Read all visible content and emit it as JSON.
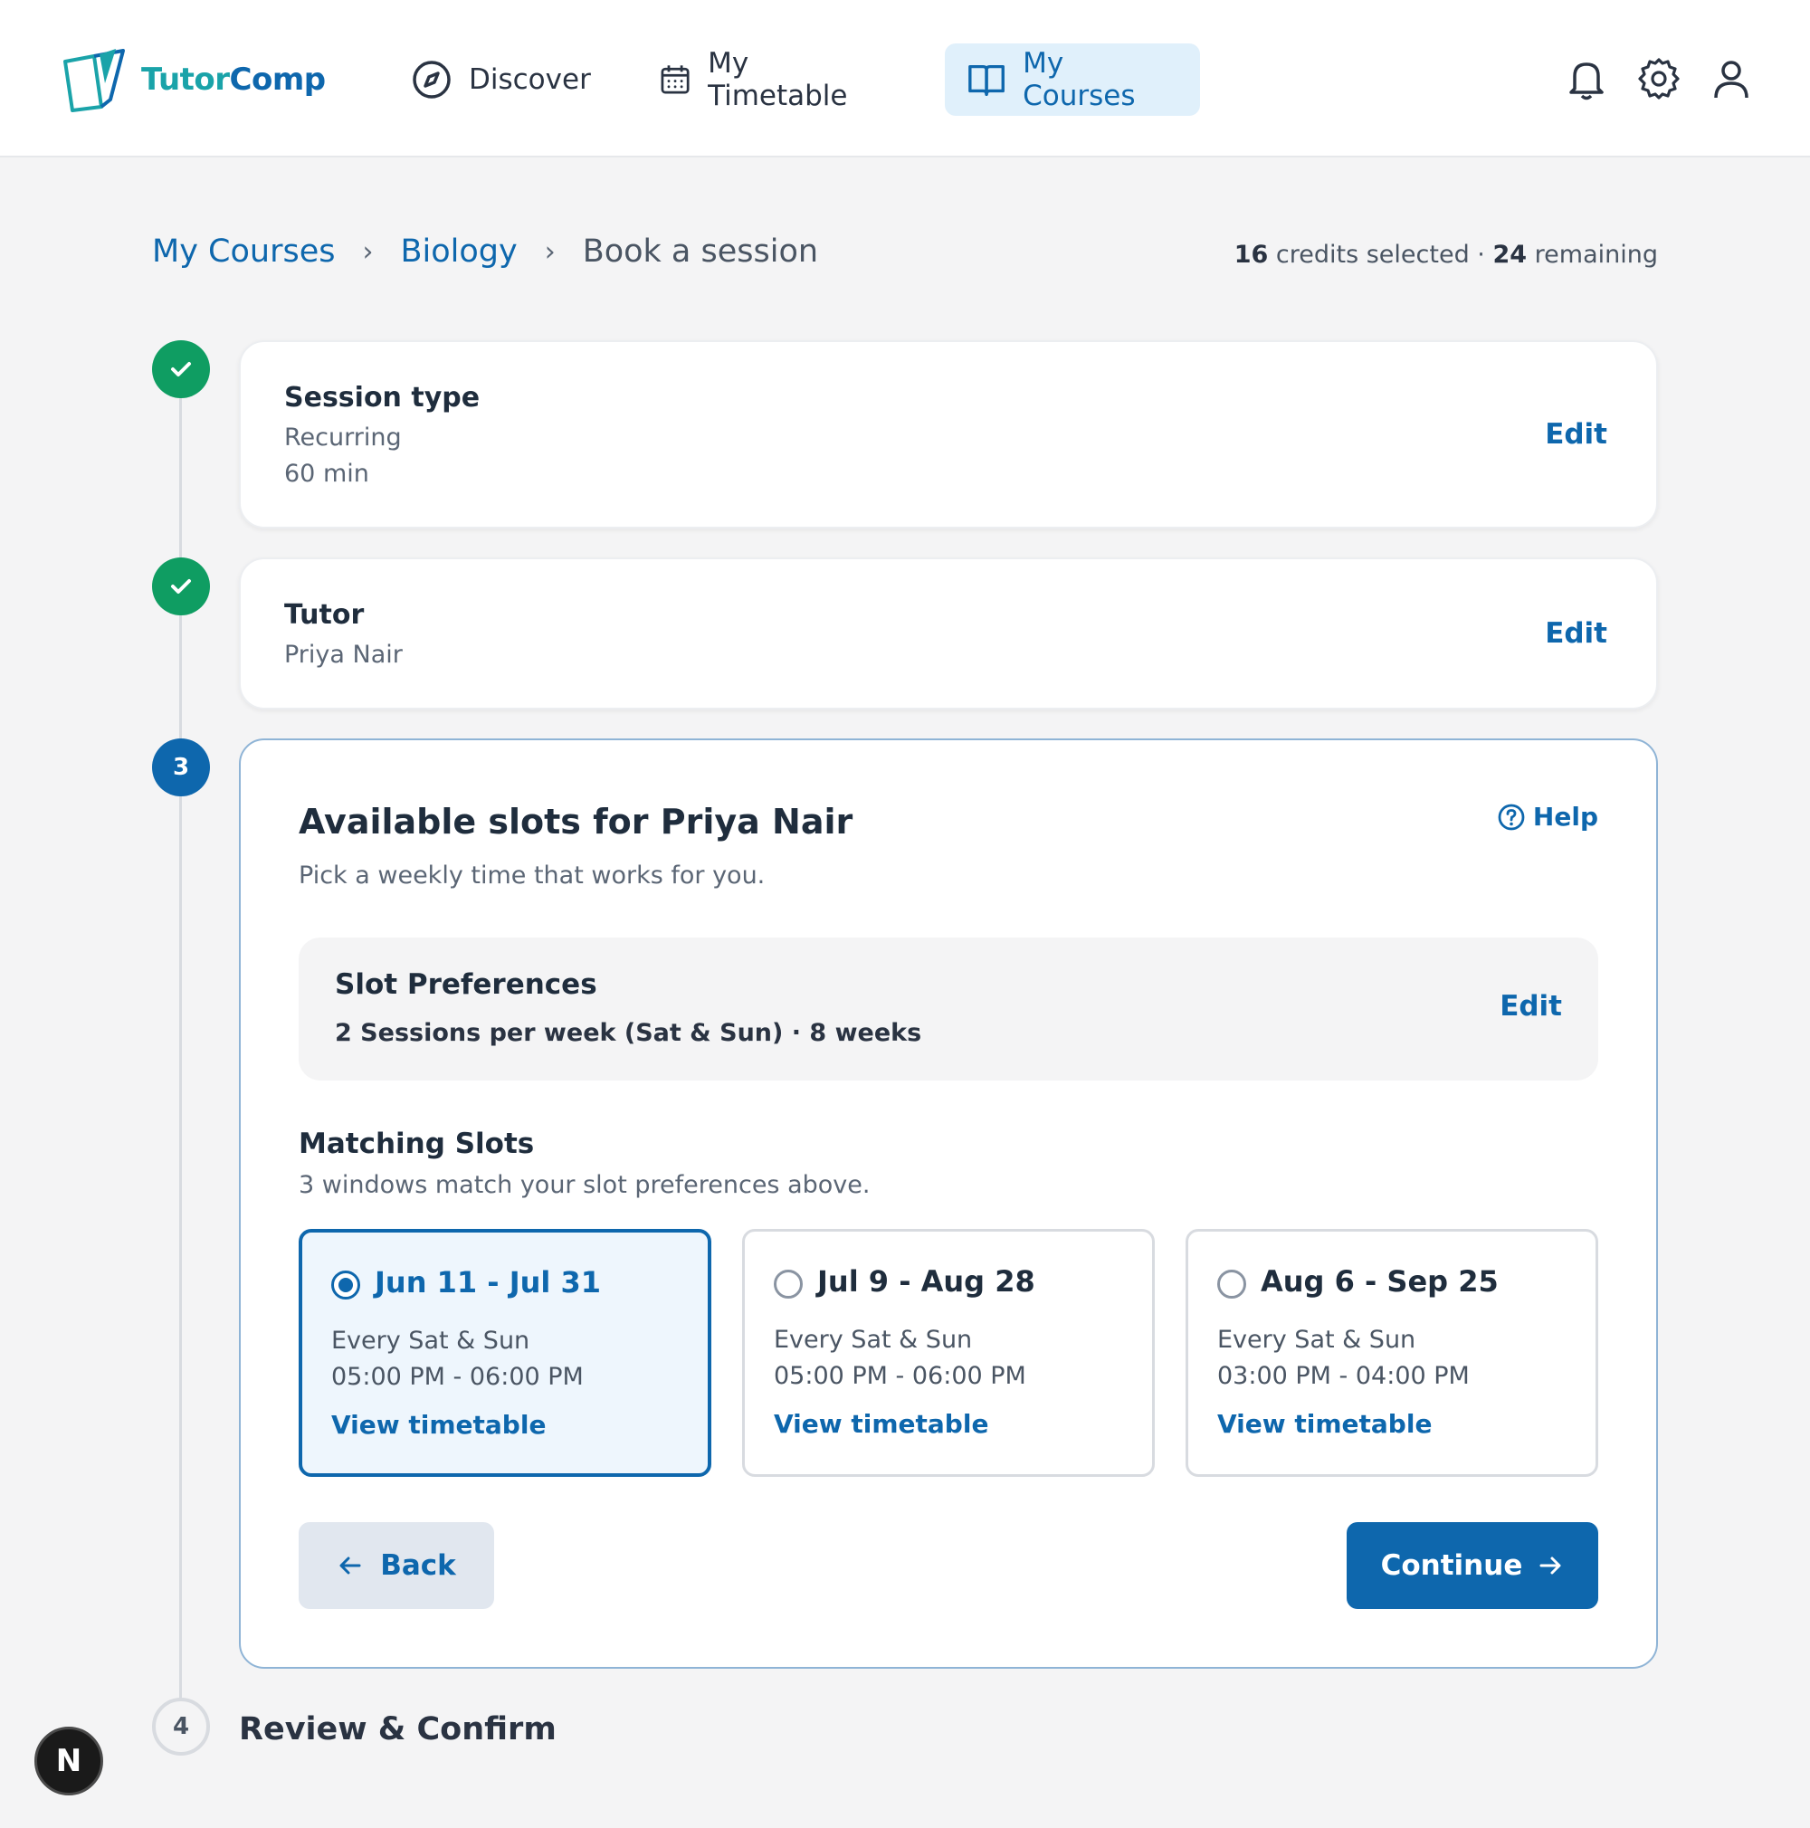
{
  "app": {
    "logo_part1": "Tutor",
    "logo_part2": "Comp"
  },
  "nav": {
    "items": [
      {
        "label": "Discover",
        "icon": "compass-icon"
      },
      {
        "label": "My Timetable",
        "icon": "calendar-icon"
      },
      {
        "label": "My Courses",
        "icon": "book-icon",
        "active": true
      }
    ],
    "icons": [
      "bell-icon",
      "gear-icon",
      "user-icon"
    ]
  },
  "breadcrumb": {
    "items": [
      "My Courses",
      "Biology"
    ],
    "current": "Book a session",
    "separator": "›"
  },
  "credits": {
    "selected": "16",
    "selected_label": "credits selected",
    "dot": "·",
    "remaining": "24",
    "remaining_label": "remaining"
  },
  "steps": [
    {
      "title": "Session type",
      "lines": [
        "Recurring",
        "60 min"
      ],
      "edit": "Edit",
      "status": "done"
    },
    {
      "title": "Tutor",
      "lines": [
        "Priya Nair"
      ],
      "edit": "Edit",
      "status": "done"
    },
    {
      "number": "3",
      "status": "current"
    },
    {
      "number": "4",
      "title": "Review & Confirm",
      "status": "todo"
    }
  ],
  "slots_section": {
    "title": "Available slots for Priya Nair",
    "subtitle": "Pick a weekly time that works for you.",
    "help": "Help",
    "preferences": {
      "title": "Slot Preferences",
      "value": "2 Sessions per week (Sat & Sun) · 8 weeks",
      "edit": "Edit"
    },
    "matching": {
      "title": "Matching Slots",
      "subtitle": "3 windows match your slot preferences above."
    },
    "slots": [
      {
        "range": "Jun 11 - Jul 31",
        "days": "Every Sat & Sun",
        "time": "05:00 PM - 06:00 PM",
        "link": "View timetable",
        "selected": true
      },
      {
        "range": "Jul 9 - Aug 28",
        "days": "Every Sat & Sun",
        "time": "05:00 PM - 06:00 PM",
        "link": "View timetable",
        "selected": false
      },
      {
        "range": "Aug 6 - Sep 25",
        "days": "Every Sat & Sun",
        "time": "03:00 PM - 04:00 PM",
        "link": "View timetable",
        "selected": false
      }
    ],
    "back": "Back",
    "continue": "Continue"
  },
  "badge": {
    "letter": "N"
  },
  "colors": {
    "primary": "#0e67ad",
    "success": "#0f9d62",
    "teal": "#1aa3a9",
    "background": "#f4f4f5"
  }
}
